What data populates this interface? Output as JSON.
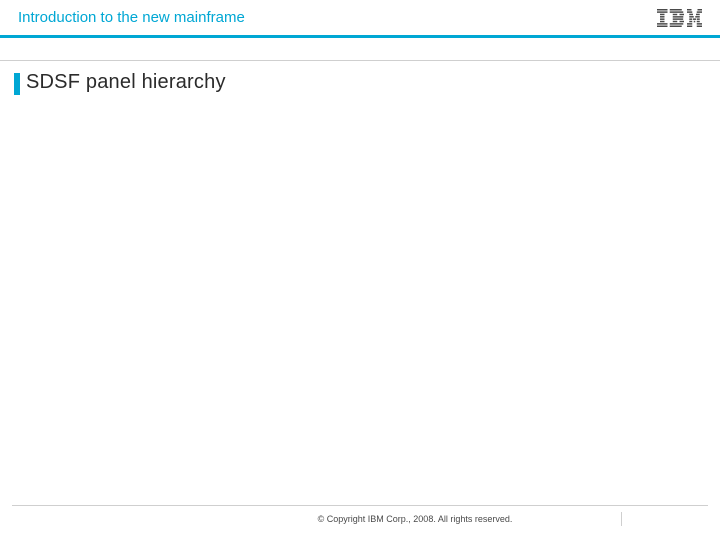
{
  "header": {
    "title": "Introduction to the new mainframe",
    "logo_name": "IBM"
  },
  "slide": {
    "title": "SDSF panel hierarchy"
  },
  "footer": {
    "copyright": "© Copyright IBM Corp., 2008. All rights reserved."
  }
}
